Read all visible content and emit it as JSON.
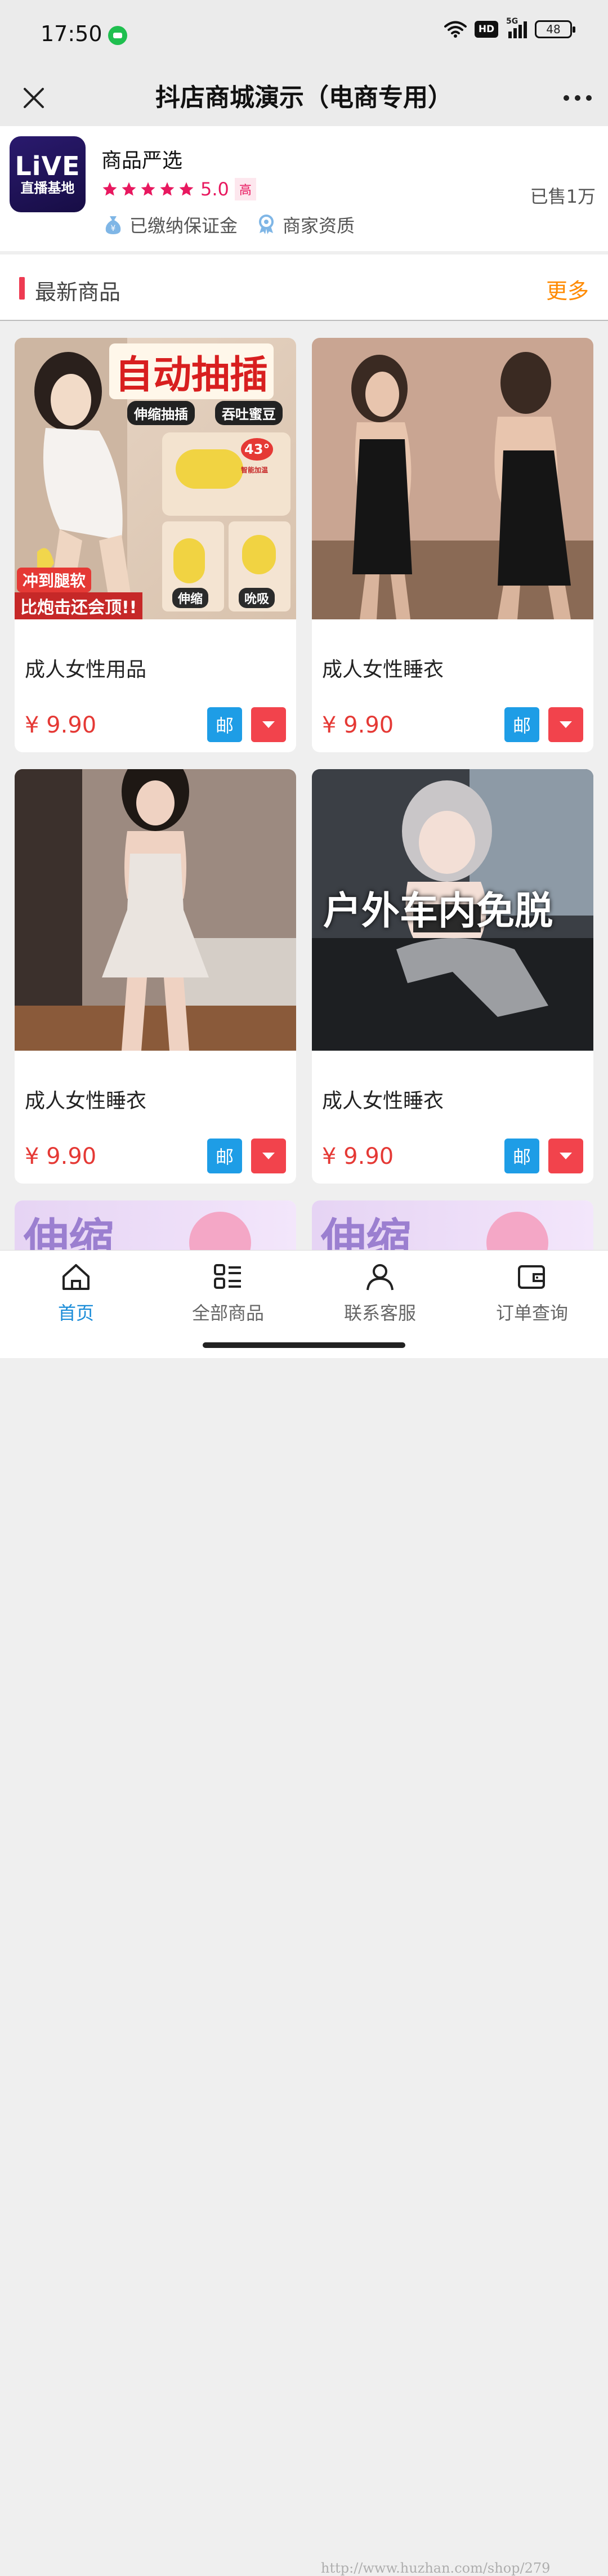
{
  "status_bar": {
    "time": "17:50",
    "network_badge": "HD",
    "network_type": "5G",
    "battery": "48"
  },
  "nav": {
    "title": "抖店商城演示（电商专用）",
    "close_icon": "close-icon",
    "more_icon": "more-dots-icon"
  },
  "shop": {
    "logo_text": "LiVE",
    "logo_subtext": "直播基地",
    "name": "商品严选",
    "rating_stars": 5,
    "rating_score": "5.0",
    "rating_level": "高",
    "sold": "已售1万",
    "badges": [
      {
        "label": "已缴纳保证金",
        "icon": "deposit-bag-icon"
      },
      {
        "label": "商家资质",
        "icon": "qualification-badge-icon"
      }
    ],
    "colors": {
      "star": "#e8185f",
      "logo_bg": "#1f1459"
    }
  },
  "section": {
    "title": "最新商品",
    "more": "更多",
    "accent": "#ee3b52",
    "more_color": "#ff8a00"
  },
  "products": [
    {
      "title": "成人女性用品",
      "price": "¥ 9.90",
      "post_label": "邮",
      "image_text": {
        "headline": "自动抽插",
        "tag1": "伸缩抽插",
        "tag2": "吞吐蜜豆",
        "temp": "43°",
        "temp_sub": "智能加温",
        "banner1": "冲到腿软",
        "banner2": "比炮击还会顶!!",
        "label1": "伸缩",
        "label2": "吮吸"
      }
    },
    {
      "title": "成人女性睡衣",
      "price": "¥ 9.90",
      "post_label": "邮"
    },
    {
      "title": "成人女性睡衣",
      "price": "¥ 9.90",
      "post_label": "邮"
    },
    {
      "title": "成人女性睡衣",
      "price": "¥ 9.90",
      "post_label": "邮",
      "image_text": {
        "headline": "户外车内免脱"
      }
    },
    {
      "image_text": {
        "headline": "伸缩"
      }
    },
    {
      "image_text": {
        "headline": "伸缩"
      }
    }
  ],
  "tab_bar": {
    "tabs": [
      {
        "label": "首页",
        "icon": "home-icon",
        "active": true
      },
      {
        "label": "全部商品",
        "icon": "all-products-icon",
        "active": false
      },
      {
        "label": "联系客服",
        "icon": "contact-service-icon",
        "active": false
      },
      {
        "label": "订单查询",
        "icon": "order-query-icon",
        "active": false
      }
    ],
    "active_color": "#1a8cd8"
  },
  "watermark": "http://www.huzhan.com/shop/279"
}
